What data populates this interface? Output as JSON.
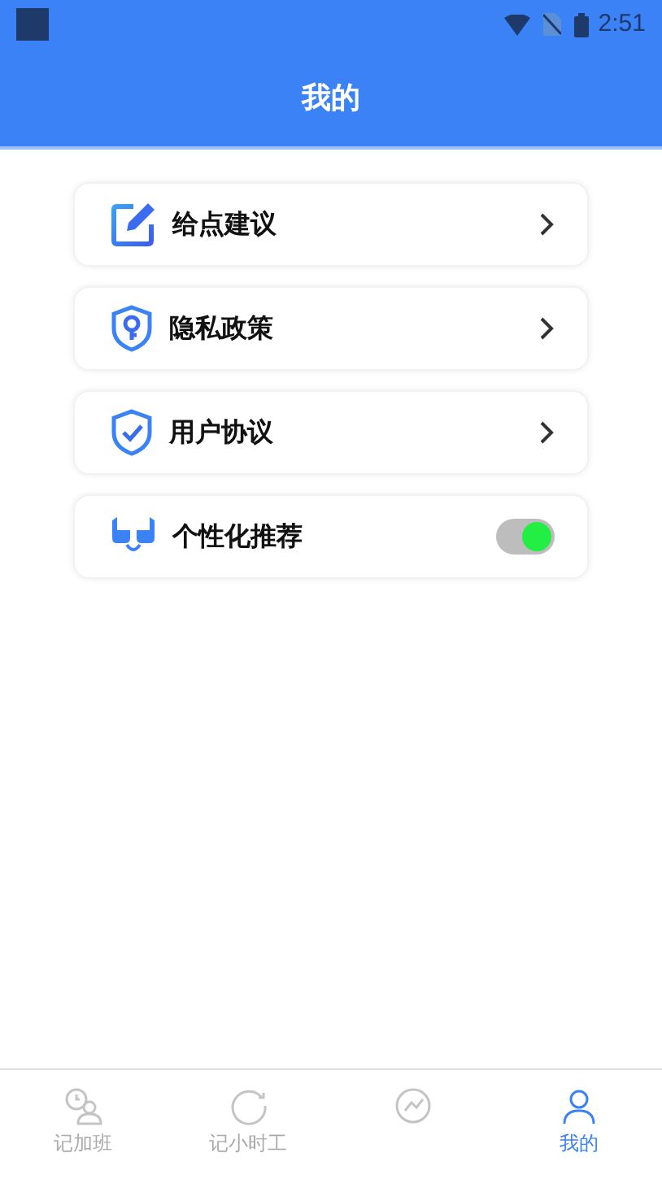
{
  "status_bar": {
    "time": "2:51"
  },
  "header": {
    "title": "我的"
  },
  "menu": [
    {
      "kind": "link",
      "label": "给点建议"
    },
    {
      "kind": "link",
      "label": "隐私政策"
    },
    {
      "kind": "link",
      "label": "用户协议"
    },
    {
      "kind": "toggle",
      "label": "个性化推荐",
      "on": true
    }
  ],
  "bottom_nav": [
    {
      "label": "记加班",
      "selected": false
    },
    {
      "label": "记小时工",
      "selected": false
    },
    {
      "selected": false
    },
    {
      "label": "我的",
      "selected": true
    }
  ]
}
